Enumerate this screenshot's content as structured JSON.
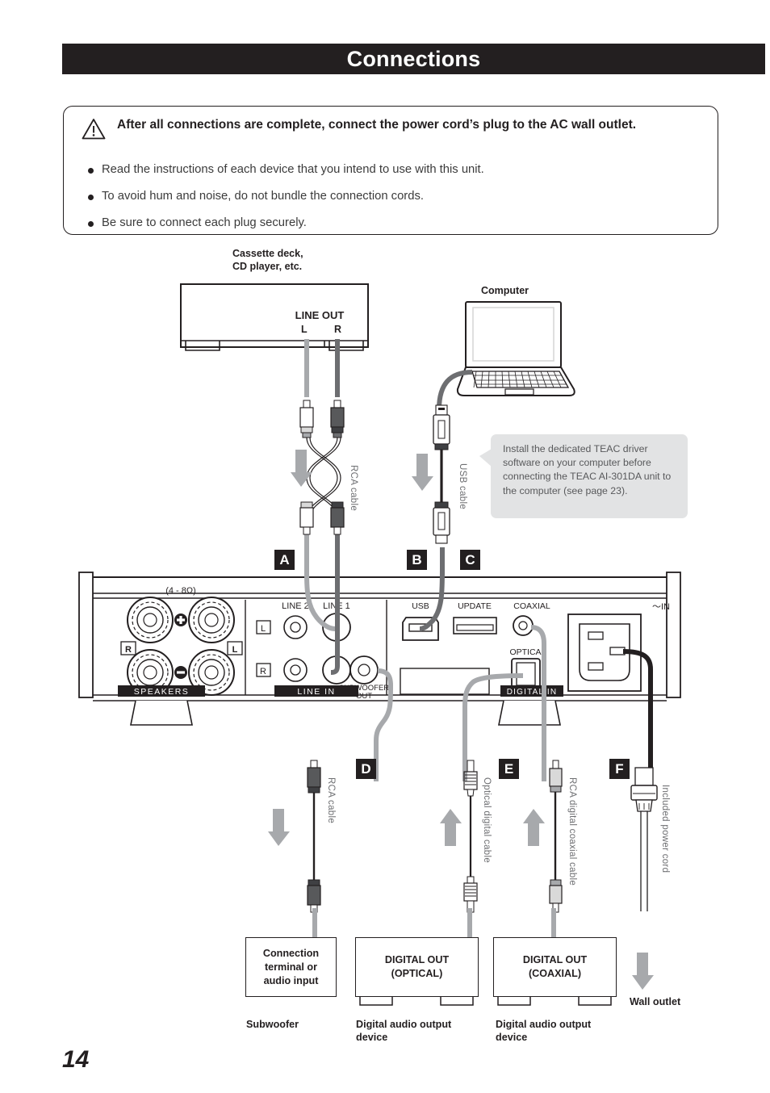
{
  "header": {
    "title": "Connections"
  },
  "notice": {
    "icon": "warning-triangle-icon",
    "heading": "After all connections are complete, connect the power cord’s plug to the AC wall outlet.",
    "bullets": [
      "Read the instructions of each device that you intend to use with this unit.",
      "To avoid hum and noise, do not bundle the connection cords.",
      "Be sure to connect each plug securely."
    ]
  },
  "diagram": {
    "source_device": {
      "label_line1": "Cassette deck,",
      "label_line2": "CD player, etc.",
      "port_group": "LINE OUT",
      "port_left": "L",
      "port_right": "R"
    },
    "computer": {
      "label": "Computer"
    },
    "callout": {
      "text": "Install the dedicated TEAC driver software on your computer before connecting the TEAC AI-301DA unit to the computer (see page 23)."
    },
    "badges": {
      "a": "A",
      "b": "B",
      "c": "C",
      "d": "D",
      "e": "E",
      "f": "F"
    },
    "cable_labels": {
      "rca_top": "RCA cable",
      "usb": "USB cable",
      "rca_sub": "RCA cable",
      "optical": "Optical digital cable",
      "coaxial": "RCA digital coaxial cable",
      "power": "Included power cord"
    },
    "rear_panel": {
      "speakers": {
        "impedance": "(4 - 8Ω)",
        "positive": "+",
        "negative": "−",
        "right": "R",
        "left": "L",
        "section_label": "SPEAKERS"
      },
      "line_in": {
        "line2": "LINE 2",
        "line1": "LINE 1",
        "left": "L",
        "right": "R",
        "section_label": "LINE IN"
      },
      "subwoofer": {
        "line1": "SUBWOOFER",
        "line2": "OUT"
      },
      "digital": {
        "usb": "USB",
        "update": "UPDATE",
        "coaxial": "COAXIAL",
        "optical": "OPTICA",
        "section_label": "DIGITAL IN"
      },
      "ac_inlet": "～ IN"
    },
    "targets": {
      "subwoofer_box_line1": "Connection",
      "subwoofer_box_line2": "terminal or",
      "subwoofer_box_line3": "audio input",
      "subwoofer_caption": "Subwoofer",
      "optical_box_line1": "DIGITAL OUT",
      "optical_box_line2": "(OPTICAL)",
      "optical_caption_line1": "Digital audio output",
      "optical_caption_line2": "device",
      "coaxial_box_line1": "DIGITAL OUT",
      "coaxial_box_line2": "(COAXIAL)",
      "coaxial_caption_line1": "Digital audio output",
      "coaxial_caption_line2": "device",
      "wall_outlet": "Wall outlet"
    }
  },
  "footer": {
    "page_number": "14"
  },
  "colors": {
    "ink": "#231f20",
    "cable_light": "#a7a9ac",
    "cable_dark": "#6d6e71",
    "callout_bg": "#e2e3e4",
    "body_text": "#58595b"
  }
}
